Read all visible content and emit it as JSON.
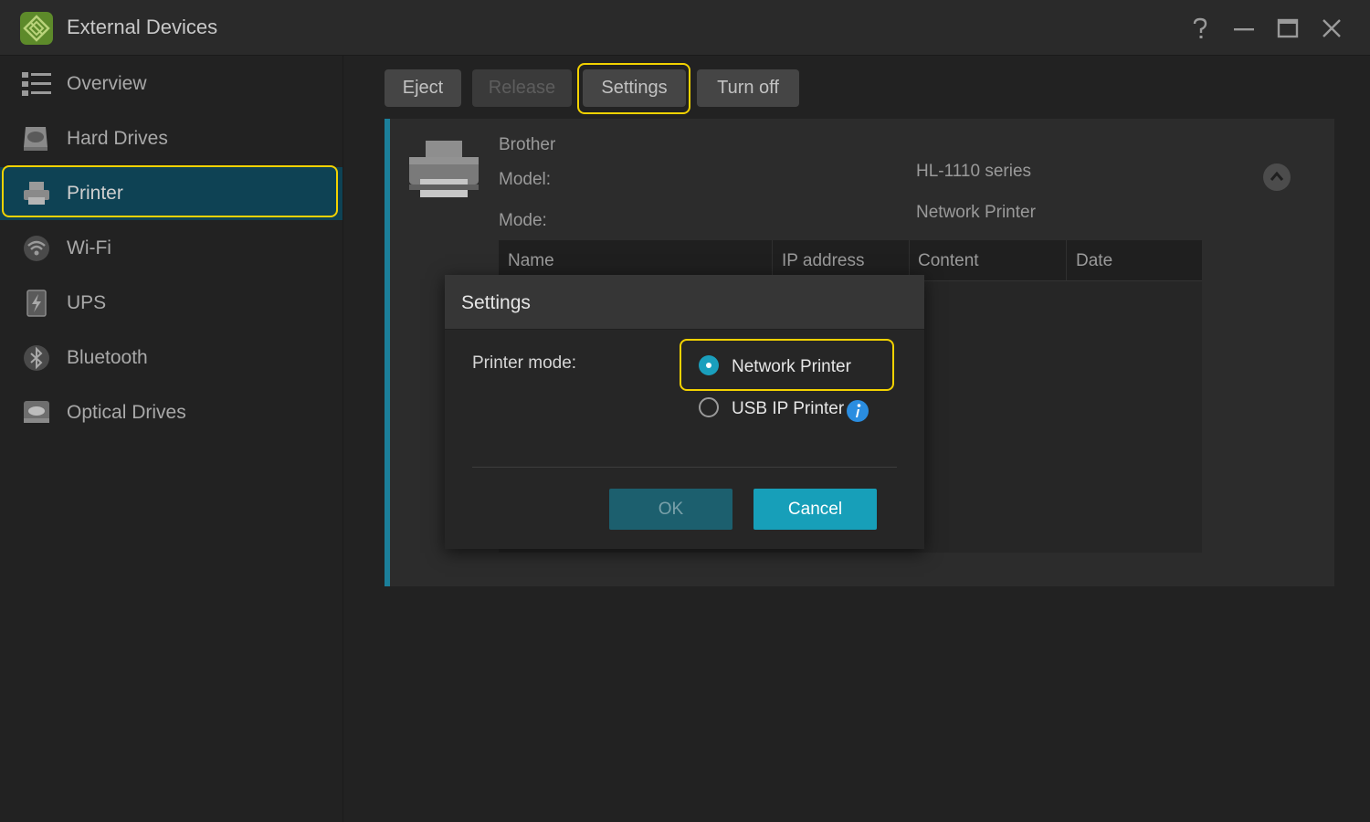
{
  "window": {
    "title": "External Devices",
    "controls": [
      "help-icon",
      "minimize-icon",
      "maximize-icon",
      "close-icon"
    ]
  },
  "sidebar": {
    "items": [
      {
        "label": "Overview",
        "icon": "overview-icon",
        "active": false
      },
      {
        "label": "Hard Drives",
        "icon": "hard-drive-icon",
        "active": false
      },
      {
        "label": "Printer",
        "icon": "printer-icon",
        "active": true
      },
      {
        "label": "Wi-Fi",
        "icon": "wifi-icon",
        "active": false
      },
      {
        "label": "UPS",
        "icon": "ups-icon",
        "active": false
      },
      {
        "label": "Bluetooth",
        "icon": "bluetooth-icon",
        "active": false
      },
      {
        "label": "Optical Drives",
        "icon": "optical-drive-icon",
        "active": false
      }
    ]
  },
  "toolbar": {
    "eject_label": "Eject",
    "release_label": "Release",
    "settings_label": "Settings",
    "turnoff_label": "Turn off"
  },
  "device": {
    "vendor": "Brother",
    "model_label": "Model:",
    "model_value": "HL-1110 series",
    "mode_label": "Mode:",
    "mode_value": "Network Printer"
  },
  "table": {
    "columns": [
      "Name",
      "IP address",
      "Content",
      "Date"
    ],
    "rows": []
  },
  "dialog": {
    "title": "Settings",
    "printer_mode_label": "Printer mode:",
    "options": [
      {
        "label": "Network Printer",
        "selected": true
      },
      {
        "label": "USB IP Printer",
        "selected": false
      }
    ],
    "ok_label": "OK",
    "cancel_label": "Cancel"
  },
  "colors": {
    "accent": "#179fb9",
    "highlight": "#f3d200",
    "active_sidebar": "#0e4254"
  }
}
